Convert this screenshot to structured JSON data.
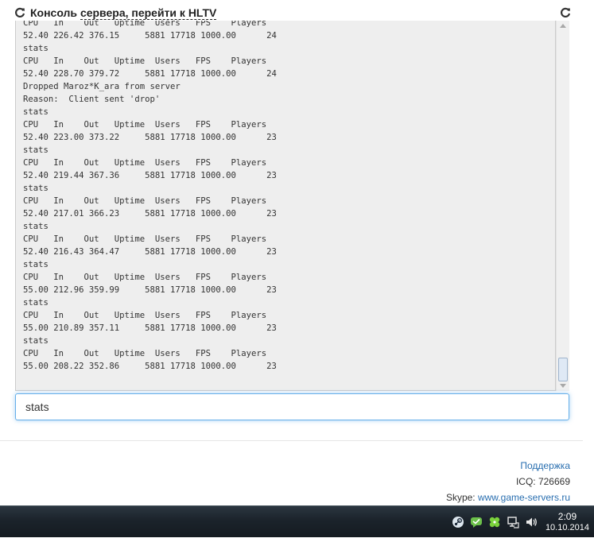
{
  "header": {
    "title_prefix": "Консоль ",
    "title_link": "сервера, перейти к HLTV"
  },
  "console": {
    "lines": [
      "CPU   In    Out   Uptime  Users   FPS    Players",
      "52.40 226.42 376.15     5881 17718 1000.00      24",
      "stats",
      "CPU   In    Out   Uptime  Users   FPS    Players",
      "52.40 228.70 379.72     5881 17718 1000.00      24",
      "Dropped Maroz*K_ara from server",
      "Reason:  Client sent 'drop'",
      "stats",
      "CPU   In    Out   Uptime  Users   FPS    Players",
      "52.40 223.00 373.22     5881 17718 1000.00      23",
      "stats",
      "CPU   In    Out   Uptime  Users   FPS    Players",
      "52.40 219.44 367.36     5881 17718 1000.00      23",
      "stats",
      "CPU   In    Out   Uptime  Users   FPS    Players",
      "52.40 217.01 366.23     5881 17718 1000.00      23",
      "stats",
      "CPU   In    Out   Uptime  Users   FPS    Players",
      "52.40 216.43 364.47     5881 17718 1000.00      23",
      "stats",
      "CPU   In    Out   Uptime  Users   FPS    Players",
      "55.00 212.96 359.99     5881 17718 1000.00      23",
      "stats",
      "CPU   In    Out   Uptime  Users   FPS    Players",
      "55.00 210.89 357.11     5881 17718 1000.00      23",
      "stats",
      "CPU   In    Out   Uptime  Users   FPS    Players",
      "55.00 208.22 352.86     5881 17718 1000.00      23"
    ]
  },
  "command": {
    "value": "stats"
  },
  "footer": {
    "support": "Поддержка",
    "icq": "ICQ: 726669",
    "skype_label": "Skype: ",
    "skype_link": "www.game-servers.ru"
  },
  "taskbar": {
    "time": "2:09",
    "date": "10.10.2014"
  },
  "colors": {
    "accent": "#2a6fb0",
    "input_focus": "#66afe9",
    "console_bg": "#eeeeee"
  },
  "icons": [
    "refresh-icon",
    "steam-icon",
    "chat-icon",
    "clover-icon",
    "network-icon",
    "volume-icon"
  ]
}
